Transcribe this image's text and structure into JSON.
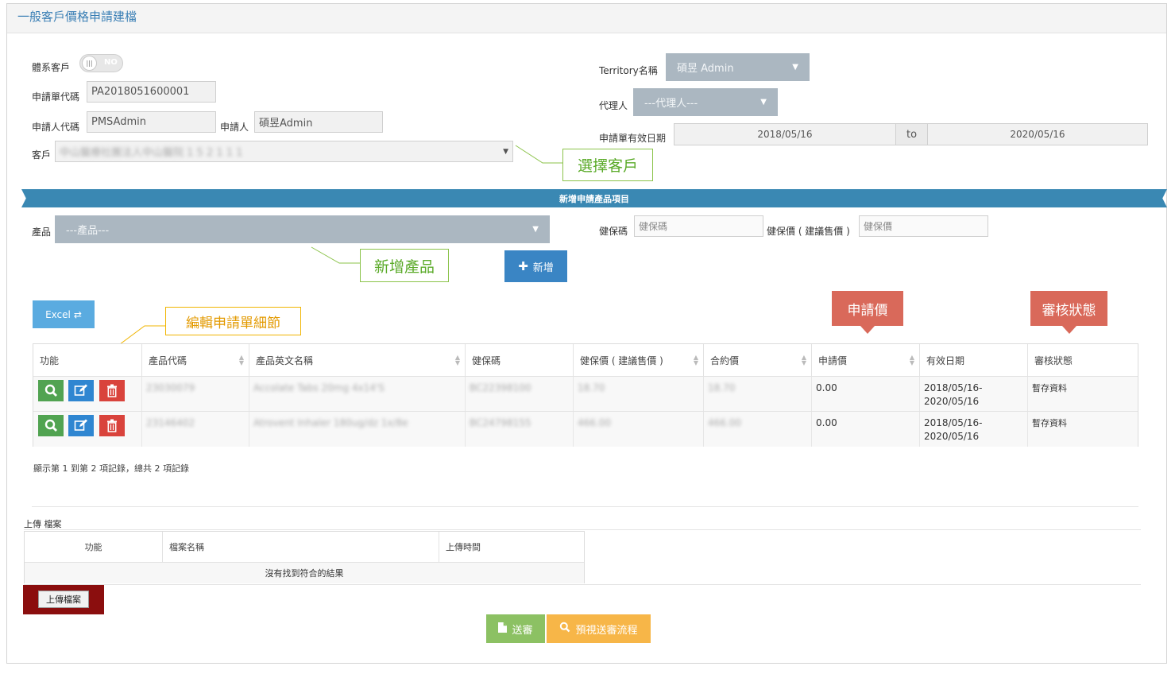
{
  "title": "一般客戶價格申請建檔",
  "form": {
    "system_customer_label": "體系客戶",
    "toggle_text": "NO",
    "app_no_label": "申請單代碼",
    "app_no_value": "PA2018051600001",
    "applicant_code_label": "申請人代碼",
    "applicant_code_value": "PMSAdmin",
    "applicant_label": "申請人",
    "applicant_value": "碩昱Admin",
    "customer_label": "客戶",
    "customer_value": "中山醫療社團法人中山醫院 1 5 2 1 1 1",
    "territory_label": "Territory名稱",
    "territory_value": "碩昱 Admin",
    "agent_label": "代理人",
    "agent_value": "---代理人---",
    "valid_label": "申請單有效日期",
    "valid_from": "2018/05/16",
    "valid_to_word": "to",
    "valid_to": "2020/05/16"
  },
  "callouts": {
    "select_customer": "選擇客戶",
    "add_product": "新增產品",
    "edit_detail": "編輯申請單細節",
    "apply_price": "申請價",
    "review_status": "審核狀態"
  },
  "banner": "新增申請產品項目",
  "product": {
    "label": "產品",
    "placeholder": "---產品---",
    "nhi_code_label": "健保碼",
    "nhi_code_placeholder": "健保碼",
    "nhi_price_label": "健保價 ( 建議售價 )",
    "nhi_price_placeholder": "健保價",
    "add_button": "新增"
  },
  "excel_button": "Excel",
  "table": {
    "headers": [
      "功能",
      "產品代碼",
      "產品英文名稱",
      "健保碼",
      "健保價 ( 建議售價 )",
      "合約價",
      "申請價",
      "有效日期",
      "審核狀態"
    ],
    "rows": [
      {
        "code": "23030079",
        "name": "Accolate Tabs 20mg 4x14'S",
        "nhi": "BC22398100",
        "nhi_price": "18.70",
        "contract": "18.70",
        "apply": "0.00",
        "date1": "2018/05/16-",
        "date2": "2020/05/16",
        "status": "暫存資料"
      },
      {
        "code": "23146402",
        "name": "Atrovent Inhaler 180ug/dz 1x/8e",
        "nhi": "BC24798155",
        "nhi_price": "466.00",
        "contract": "466.00",
        "apply": "0.00",
        "date1": "2018/05/16-",
        "date2": "2020/05/16",
        "status": "暫存資料"
      }
    ],
    "footer": "顯示第 1 到第 2 項記錄，總共 2 項記錄"
  },
  "upload": {
    "title": "上傳 檔案",
    "headers": [
      "功能",
      "檔案名稱",
      "上傳時間"
    ],
    "empty": "沒有找到符合的結果",
    "button": "上傳檔案"
  },
  "actions": {
    "submit": "送審",
    "preview": "預視送審流程"
  },
  "colors": {
    "banner": "#3a88b3",
    "search": "#51a351",
    "edit": "#2f86d1",
    "delete": "#d9433c",
    "submit": "#8cc163",
    "preview": "#f7b648"
  }
}
